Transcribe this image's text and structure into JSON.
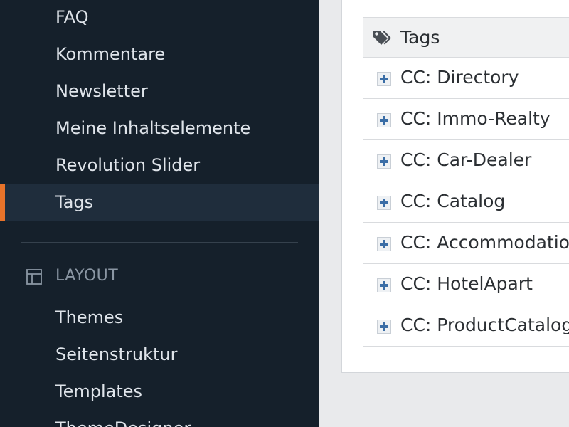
{
  "sidebar": {
    "items": [
      {
        "label": "FAQ"
      },
      {
        "label": "Kommentare"
      },
      {
        "label": "Newsletter"
      },
      {
        "label": "Meine Inhaltselemente"
      },
      {
        "label": "Revolution Slider"
      },
      {
        "label": "Tags",
        "active": true
      }
    ],
    "layout_section": {
      "title": "LAYOUT",
      "icon": "layout-icon",
      "items": [
        {
          "label": "Themes"
        },
        {
          "label": "Seitenstruktur"
        },
        {
          "label": "Templates"
        },
        {
          "label": "ThemeDesigner"
        }
      ]
    },
    "colors": {
      "background": "#15202b",
      "active_background": "#1f2d3c",
      "active_accent": "#e8732a"
    }
  },
  "main": {
    "header": {
      "title": "Tags",
      "icon": "tags-icon"
    },
    "rows": [
      {
        "label": "CC: Directory",
        "icon": "plus-icon"
      },
      {
        "label": "CC: Immo-Realty",
        "icon": "plus-icon"
      },
      {
        "label": "CC: Car-Dealer",
        "icon": "plus-icon"
      },
      {
        "label": "CC: Catalog",
        "icon": "plus-icon"
      },
      {
        "label": "CC: Accommodation",
        "icon": "plus-icon"
      },
      {
        "label": "CC: HotelApart",
        "icon": "plus-icon"
      },
      {
        "label": "CC: ProductCatalog",
        "icon": "plus-icon"
      }
    ],
    "colors": {
      "plus": "#3a6da6"
    }
  }
}
